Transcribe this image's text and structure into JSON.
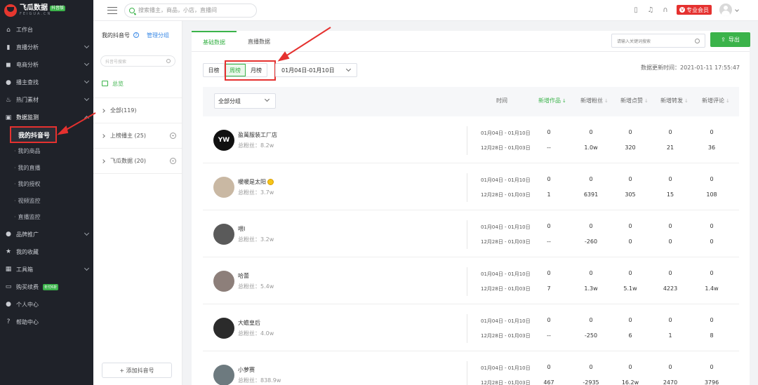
{
  "app": {
    "name": "飞瓜数据",
    "badge": "抖音版",
    "sub": "FEIGUA.CN"
  },
  "sidebar": {
    "items": [
      {
        "label": "工作台",
        "icon": "home-icon",
        "glyph": "⌂"
      },
      {
        "label": "直播分析",
        "icon": "bar-chart-icon",
        "glyph": "▮"
      },
      {
        "label": "电商分析",
        "icon": "bag-icon",
        "glyph": "◼"
      },
      {
        "label": "播主查找",
        "icon": "user-search-icon",
        "glyph": "●"
      },
      {
        "label": "热门素材",
        "icon": "fire-icon",
        "glyph": "♨"
      },
      {
        "label": "数据监测",
        "icon": "monitor-icon",
        "glyph": "▣"
      }
    ],
    "sub_items": [
      "我的抖音号",
      "我的商品",
      "我的直播",
      "我的授权",
      "视频监控",
      "直播监控"
    ],
    "items2": [
      {
        "label": "品牌推广",
        "icon": "brand-icon",
        "glyph": "●"
      },
      {
        "label": "我的收藏",
        "icon": "star-icon",
        "glyph": "★"
      },
      {
        "label": "工具箱",
        "icon": "toolbox-icon",
        "glyph": "▦"
      },
      {
        "label": "购买续费",
        "icon": "card-icon",
        "glyph": "▭",
        "pill": "年付6折"
      },
      {
        "label": "个人中心",
        "icon": "person-icon",
        "glyph": "●"
      },
      {
        "label": "帮助中心",
        "icon": "help-icon",
        "glyph": "?"
      }
    ]
  },
  "topbar": {
    "search_placeholder": "搜索播主，商品，小店，直播间",
    "vip": "专业会员"
  },
  "left_panel": {
    "title": "我的抖音号",
    "manage": "管理分组",
    "search_placeholder": "抖音号搜索",
    "overview": "总览",
    "groups": [
      "全部(119)",
      "上榜播主 (25)",
      "飞瓜数据 (20)"
    ],
    "add": "+ 添加抖音号"
  },
  "main": {
    "tabs": [
      "基础数据",
      "直播数据"
    ],
    "keyword_placeholder": "请输入关键词搜索",
    "export": "导出",
    "period": [
      "日榜",
      "周榜",
      "月榜"
    ],
    "date_range": "01月04日-01月10日",
    "update_time": "数据更新时间：2021-01-11 17:55:47",
    "group_select": "全部分组",
    "columns": [
      "时间",
      "新增作品",
      "新增粉丝",
      "新增点赞",
      "新增转发",
      "新增评论"
    ]
  },
  "rows": [
    {
      "name": "盈萬服装工厂店",
      "fans": "总粉丝：8.2w",
      "avatar_bg": "#111111",
      "avatar_text": "YW",
      "d1": "01月04日 - 01月10日",
      "d2": "12月28日 - 01月03日",
      "v1": [
        "0",
        "0",
        "0",
        "0",
        "0"
      ],
      "v2": [
        "--",
        "1.0w",
        "320",
        "21",
        "36"
      ]
    },
    {
      "name": "暖暖是太阳",
      "fans": "总粉丝：3.7w",
      "avatar_bg": "#c9b8a3",
      "avatar_text": "",
      "d1": "01月04日 - 01月10日",
      "d2": "12月28日 - 01月03日",
      "v1": [
        "0",
        "0",
        "0",
        "0",
        "0"
      ],
      "v2": [
        "1",
        "6391",
        "305",
        "15",
        "108"
      ]
    },
    {
      "name": "喂I",
      "fans": "总粉丝：3.2w",
      "avatar_bg": "#5a5a5a",
      "avatar_text": "",
      "d1": "01月04日 - 01月10日",
      "d2": "12月28日 - 01月03日",
      "v1": [
        "0",
        "0",
        "0",
        "0",
        "0"
      ],
      "v2": [
        "--",
        "-260",
        "0",
        "0",
        "0"
      ]
    },
    {
      "name": "哈蕾",
      "fans": "总粉丝：5.4w",
      "avatar_bg": "#8d7f7a",
      "avatar_text": "",
      "d1": "01月04日 - 01月10日",
      "d2": "12月28日 - 01月03日",
      "v1": [
        "0",
        "0",
        "0",
        "0",
        "0"
      ],
      "v2": [
        "7",
        "1.3w",
        "5.1w",
        "4223",
        "1.4w"
      ]
    },
    {
      "name": "大蟾皇后",
      "fans": "总粉丝：4.0w",
      "avatar_bg": "#2b2b2b",
      "avatar_text": "",
      "d1": "01月04日 - 01月10日",
      "d2": "12月28日 - 01月03日",
      "v1": [
        "0",
        "0",
        "0",
        "0",
        "0"
      ],
      "v2": [
        "--",
        "-250",
        "6",
        "1",
        "8"
      ]
    },
    {
      "name": "小萝赛",
      "fans": "总粉丝：838.9w",
      "avatar_bg": "#6d7a7f",
      "avatar_text": "",
      "d1": "01月04日 - 01月10日",
      "d2": "12月28日 - 01月03日",
      "v1": [
        "0",
        "0",
        "0",
        "0",
        "0"
      ],
      "v2": [
        "467",
        "-2935",
        "16.2w",
        "2470",
        "3796"
      ]
    }
  ]
}
